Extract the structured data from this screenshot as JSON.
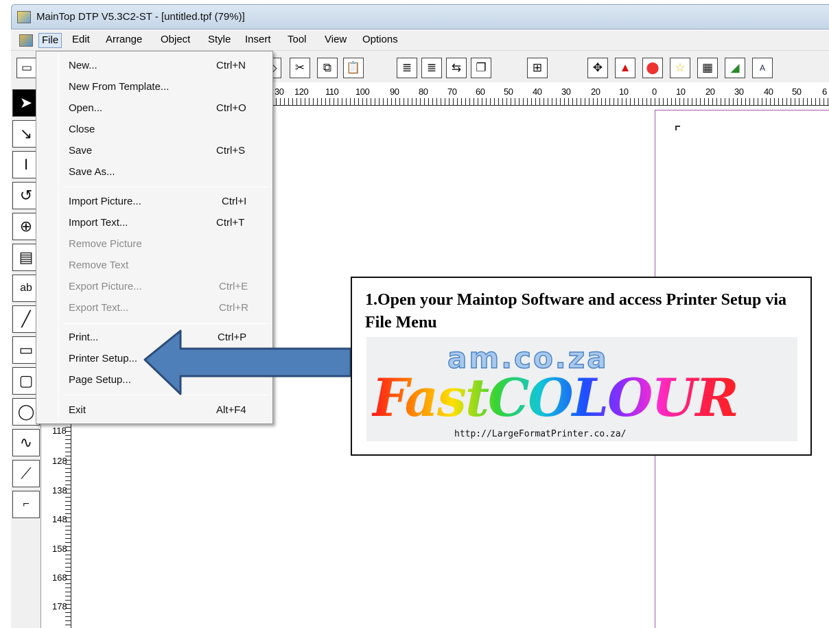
{
  "window": {
    "title": "MainTop DTP V5.3C2-ST - [untitled.tpf (79%)]"
  },
  "menubar": [
    "File",
    "Edit",
    "Arrange",
    "Object",
    "Style",
    "Insert",
    "Tool",
    "View",
    "Options"
  ],
  "file_menu": {
    "items": [
      {
        "label": "New...",
        "shortcut": "Ctrl+N",
        "enabled": true
      },
      {
        "label": "New From Template...",
        "shortcut": "",
        "enabled": true
      },
      {
        "label": "Open...",
        "shortcut": "Ctrl+O",
        "enabled": true
      },
      {
        "label": "Close",
        "shortcut": "",
        "enabled": true
      },
      {
        "label": "Save",
        "shortcut": "Ctrl+S",
        "enabled": true
      },
      {
        "label": "Save As...",
        "shortcut": "",
        "enabled": true
      },
      {
        "label": "Import Picture...",
        "shortcut": "Ctrl+I",
        "enabled": true
      },
      {
        "label": "Import Text...",
        "shortcut": "Ctrl+T",
        "enabled": true
      },
      {
        "label": "Remove Picture",
        "shortcut": "",
        "enabled": false
      },
      {
        "label": "Remove Text",
        "shortcut": "",
        "enabled": false
      },
      {
        "label": "Export Picture...",
        "shortcut": "Ctrl+E",
        "enabled": false
      },
      {
        "label": "Export Text...",
        "shortcut": "Ctrl+R",
        "enabled": false
      },
      {
        "label": "Print...",
        "shortcut": "Ctrl+P",
        "enabled": true
      },
      {
        "label": "Printer Setup...",
        "shortcut": "",
        "enabled": true
      },
      {
        "label": "Page Setup...",
        "shortcut": "",
        "enabled": true
      },
      {
        "label": "Exit",
        "shortcut": "Alt+F4",
        "enabled": true
      }
    ]
  },
  "ruler": {
    "horizontal": [
      "30",
      "120",
      "110",
      "100",
      "90",
      "80",
      "70",
      "60",
      "50",
      "40",
      "30",
      "20",
      "10",
      "0",
      "10",
      "20",
      "30",
      "40",
      "50",
      "6"
    ],
    "vertical": [
      "118",
      "128",
      "138",
      "148",
      "158",
      "168",
      "178"
    ]
  },
  "callout": {
    "text": "1.Open your Maintop Software and access Printer Setup via File Menu",
    "logo_top": "am.co.za",
    "logo_main": "FastCOLOUR",
    "logo_url": "http://LargeFormatPrinter.co.za/"
  },
  "colors": {
    "arrow_fill": "#4f7fb8",
    "arrow_stroke": "#2c4d7a",
    "page_border": "#a05ba8"
  }
}
